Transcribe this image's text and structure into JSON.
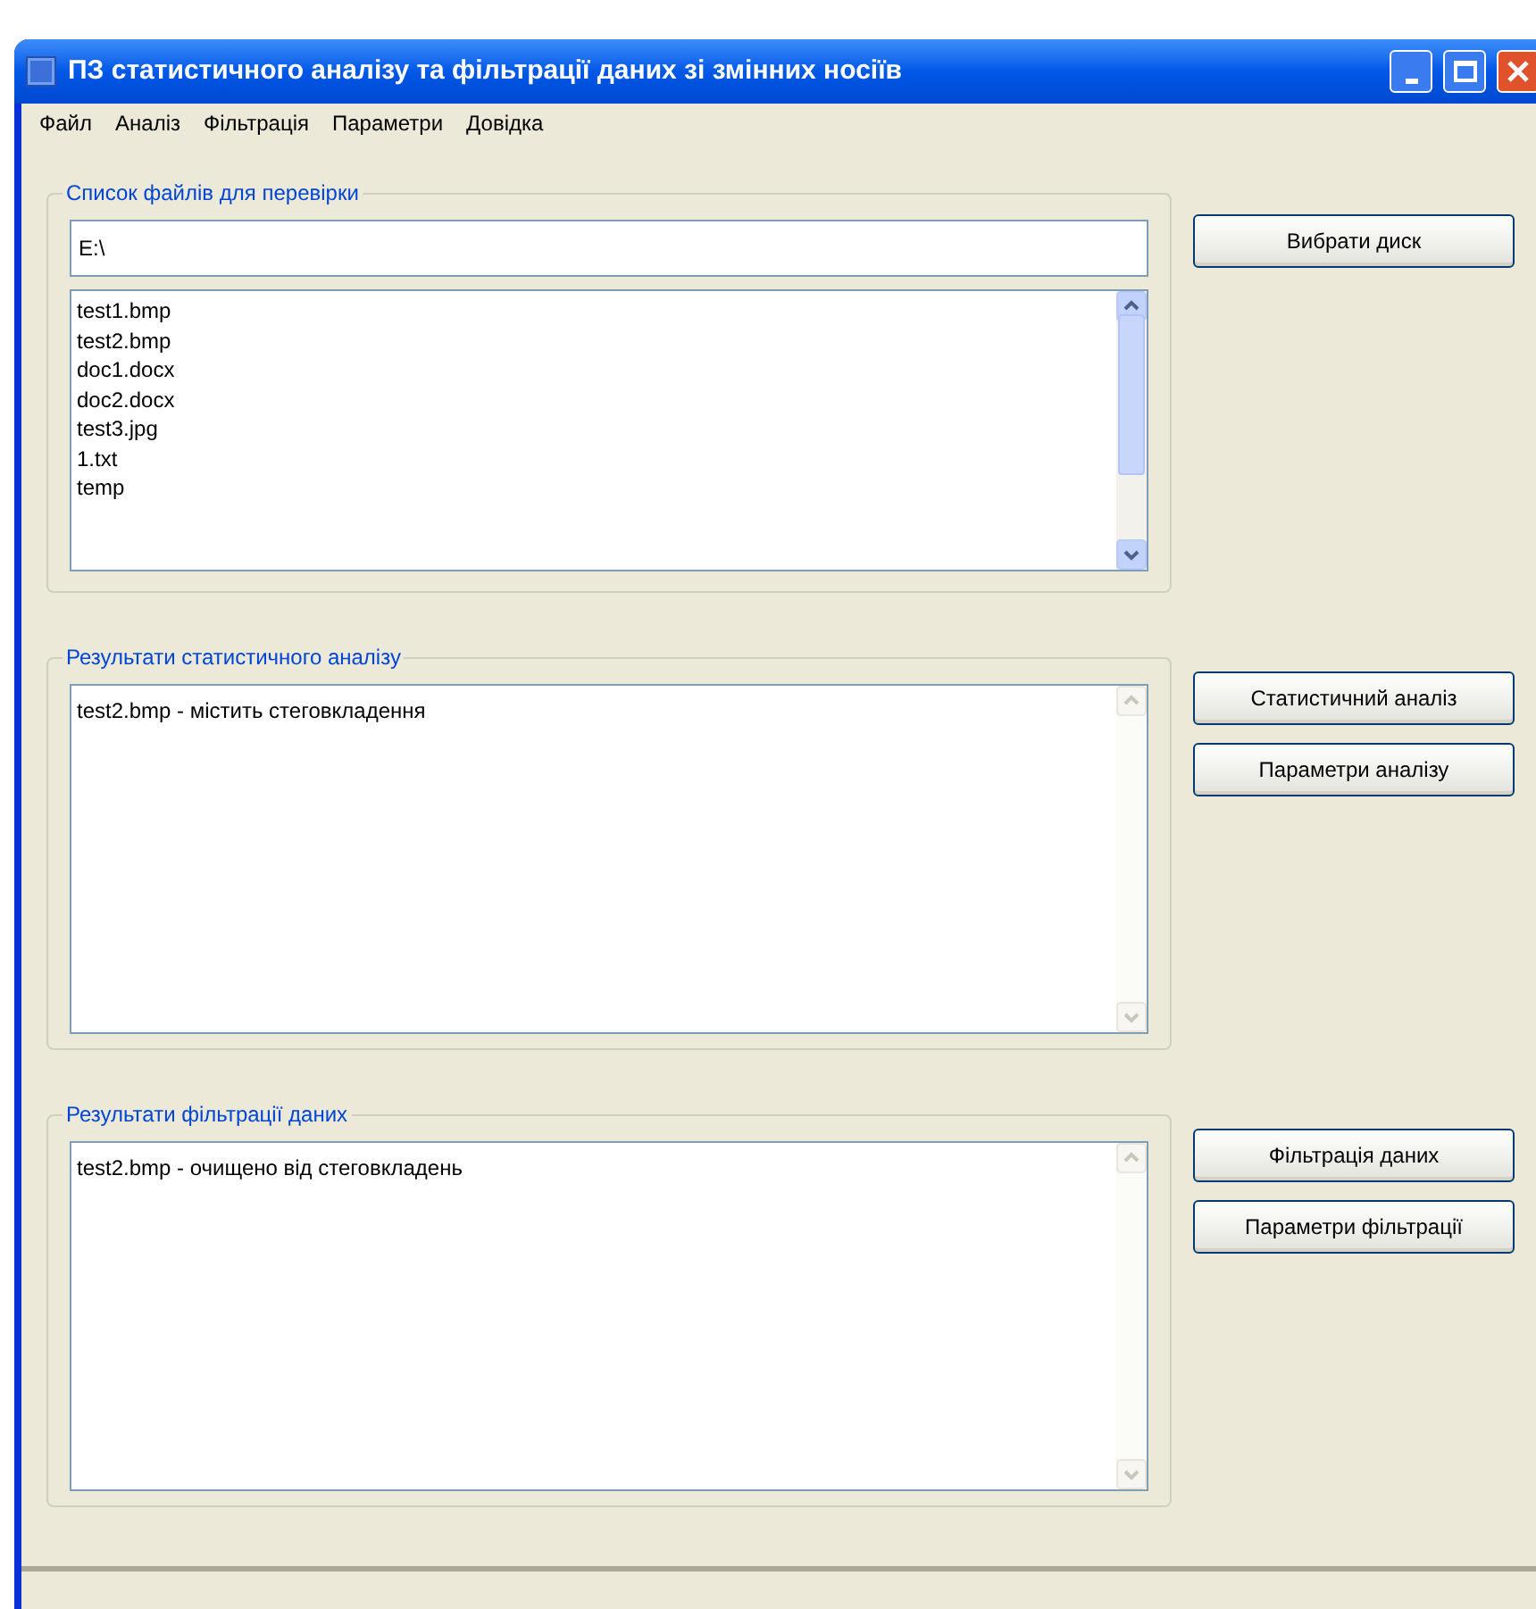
{
  "window": {
    "title": "ПЗ статистичного аналізу та фільтрації даних зі змінних носіїв"
  },
  "menu": [
    "Файл",
    "Аналіз",
    "Фільтрація",
    "Параметри",
    "Довідка"
  ],
  "files_group": {
    "label": "Список файлів для перевірки",
    "path": "E:\\",
    "files": [
      "test1.bmp",
      "test2.bmp",
      "doc1.docx",
      "doc2.docx",
      "test3.jpg",
      "1.txt",
      "temp"
    ],
    "button": "Вибрати диск"
  },
  "analysis_group": {
    "label": "Результати статистичного аналізу",
    "text": "test2.bmp - містить стеговкладення",
    "buttons": [
      "Статистичний аналіз",
      "Параметри аналізу"
    ]
  },
  "filter_group": {
    "label": "Результати фільтрації даних",
    "text": "test2.bmp - очищено від стеговкладень",
    "buttons": [
      "Фільтрація даних",
      "Параметри фільтрації"
    ]
  }
}
